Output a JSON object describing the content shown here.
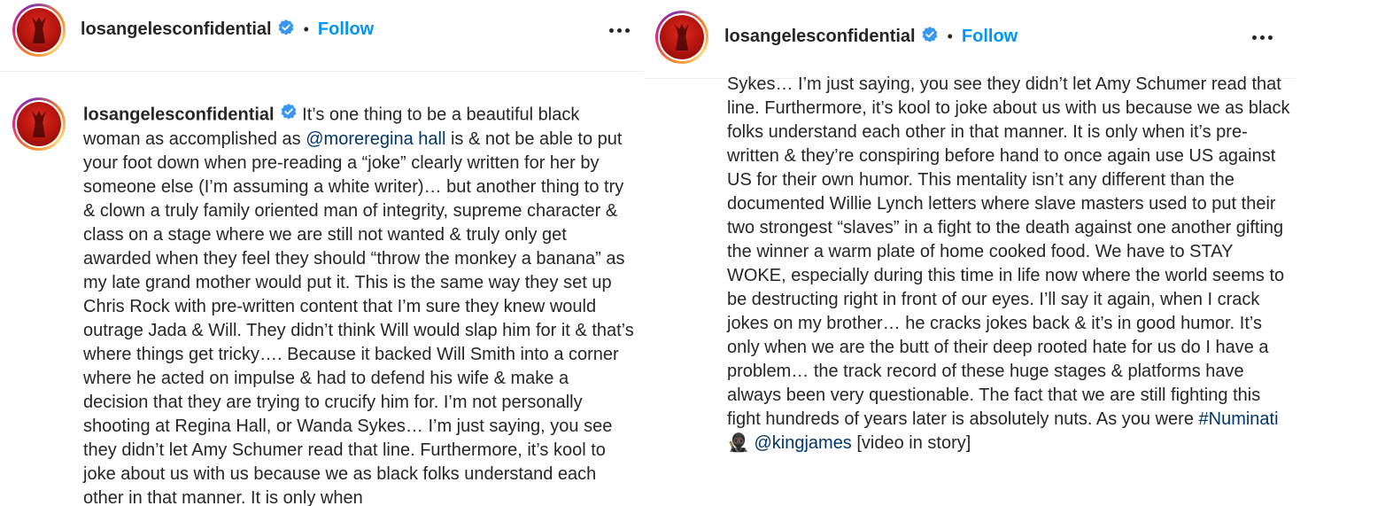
{
  "post": {
    "username": "losangelesconfidential",
    "follow_label": "Follow",
    "separator": "•"
  },
  "caption": {
    "username": "losangelesconfidential",
    "left_segments": {
      "p1": "It’s one thing to be a beautiful black woman as accomplished as",
      "mention1": "@moreregina hall",
      "p2": "is & not be able to put your foot down when pre-reading a “joke” clearly written for her by someone else (I’m assuming a white writer)… but another thing to try & clown a truly family oriented man of integrity, supreme character & class on a stage where we are still not wanted & truly only get awarded when they feel they should “throw the monkey a banana” as my late grand mother would put it. This is the same way they set up Chris Rock with pre-written content that I’m sure they knew would outrage Jada & Will. They didn’t think Will would slap him for it & that’s where things get tricky…. Because it backed Will Smith into a corner where he acted on impulse & had to defend his wife & make a decision that they are trying to crucify him for. I’m not personally shooting at Regina Hall, or Wanda Sykes… I’m just saying, you see they didn’t let Amy Schumer read that line. Furthermore, it’s kool to joke about us with us because we as black folks understand each other in that manner. It is only when"
    },
    "right_segments": {
      "p1": "Sykes… I’m just saying, you see they didn’t let Amy Schumer read that line. Furthermore, it’s kool to joke about us with us because we as black folks understand each other in that manner. It is only when it’s pre-written & they’re conspiring before hand to once again use US against US for their own humor. This mentality isn’t any different than the documented Willie Lynch letters where slave masters used to put their two strongest “slaves” in a fight to the death against one another gifting the winner a warm plate of home cooked food. We have to STAY WOKE, especially during this time in life now where the world seems to be destructing right in front of our eyes. I’ll say it again, when I crack jokes on my brother… he cracks jokes back & it’s in good humor. It’s only when we are the butt of their deep rooted hate for us do I have a problem… the track record of these huge stages & platforms have always been very questionable. The fact that we are still fighting this fight hundreds of years later is absolutely nuts. As you were",
      "hashtag": "#Numinati",
      "emoji": "🥷🏿",
      "mention": "@kingjames",
      "p2": "[video in story]"
    }
  },
  "colors": {
    "accent": "#0095f6",
    "link": "#00376b",
    "text": "#262626",
    "verified": "#3897f0"
  },
  "icons": [
    "verified-badge-icon",
    "more-options-icon"
  ]
}
